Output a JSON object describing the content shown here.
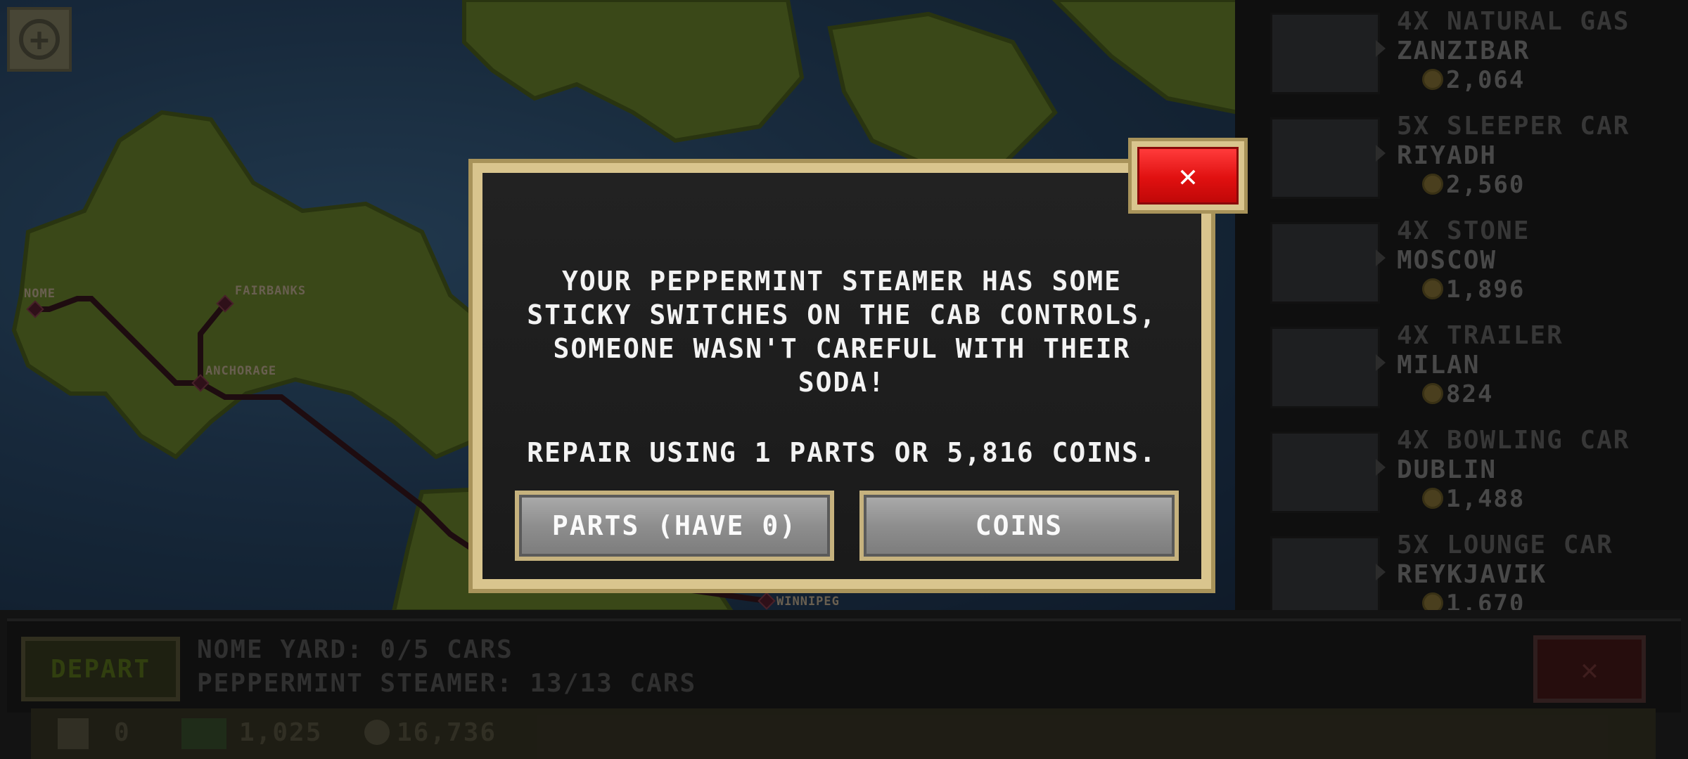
{
  "map": {
    "cities": [
      {
        "name": "NOME"
      },
      {
        "name": "FAIRBANKS"
      },
      {
        "name": "ANCHORAGE"
      },
      {
        "name": "WINNIPEG"
      }
    ]
  },
  "cargo_list": [
    {
      "title": "4X NATURAL GAS",
      "city": "ZANZIBAR",
      "price": "2,064"
    },
    {
      "title": "5X SLEEPER CAR",
      "city": "RIYADH",
      "price": "2,560"
    },
    {
      "title": "4X STONE",
      "city": "MOSCOW",
      "price": "1,896"
    },
    {
      "title": "4X TRAILER",
      "city": "MILAN",
      "price": "824"
    },
    {
      "title": "4X BOWLING CAR",
      "city": "DUBLIN",
      "price": "1,488"
    },
    {
      "title": "5X LOUNGE CAR",
      "city": "REYKJAVIK",
      "price": "1,670"
    }
  ],
  "bottom": {
    "depart_label": "DEPART",
    "yard_status": "NOME YARD: 0/5 CARS",
    "train_status": "PEPPERMINT STEAMER: 13/13 CARS",
    "close_label": "✕"
  },
  "stats": {
    "parts": "0",
    "cash": "1,025",
    "coins": "16,736"
  },
  "modal": {
    "message": "YOUR PEPPERMINT STEAMER HAS SOME STICKY SWITCHES ON THE CAB CONTROLS, SOMEONE WASN'T CAREFUL WITH THEIR SODA!",
    "repair_text": "REPAIR USING 1 PARTS OR 5,816 COINS.",
    "parts_button": "PARTS (HAVE 0)",
    "coins_button": "COINS",
    "close_label": "✕"
  },
  "colors": {
    "modal_frame": "#d9c58e",
    "close_red": "#e01010",
    "land": "#6f8a2e",
    "water": "#3f6b93"
  }
}
